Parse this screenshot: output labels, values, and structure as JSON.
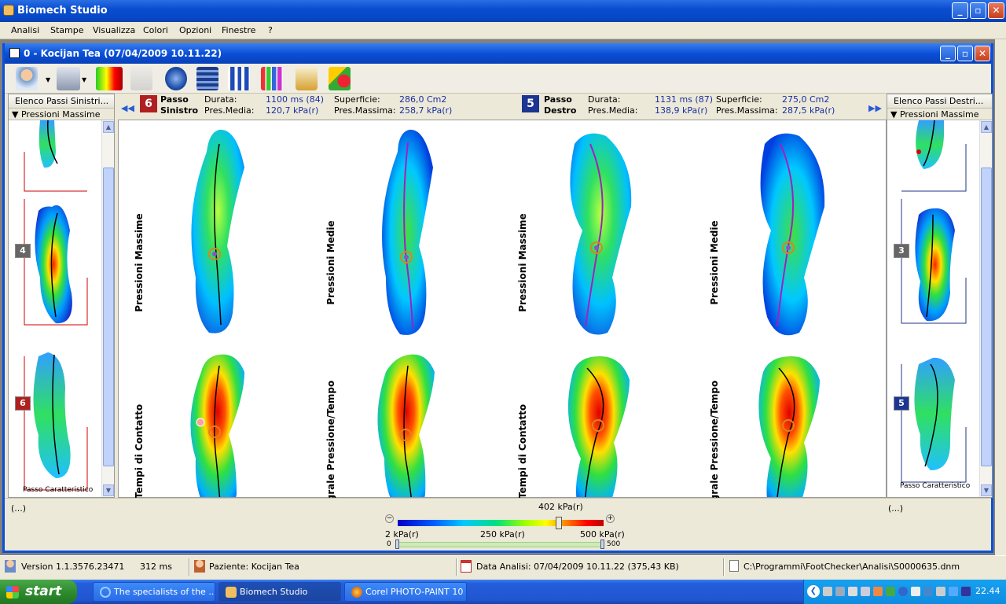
{
  "app": {
    "title": "Biomech Studio"
  },
  "menu": [
    "Analisi",
    "Stampe",
    "Visualizza",
    "Colori",
    "Opzioni",
    "Finestre",
    "?"
  ],
  "child": {
    "title": "0 -  Kocijan Tea  (07/04/2009 10.11.22)"
  },
  "toolbar_icons": [
    "patient-icon",
    "print-icon",
    "pressure-chart-icon",
    "foot-shade-icon",
    "globe-icon",
    "film-icon",
    "feet-icon",
    "bar-chart-icon",
    "scale-icon",
    "shapes-icon"
  ],
  "left_panel": {
    "header": "Elenco Passi Sinistri...",
    "sub": "Pressioni Massime",
    "steps": [
      "4",
      "6"
    ],
    "caption": "Passo Caratteristico"
  },
  "right_panel": {
    "header": "Elenco Passi Destri...",
    "sub": "Pressioni Massime",
    "steps": [
      "3",
      "5"
    ],
    "caption": "Passo Caratteristico"
  },
  "left_step": {
    "number": "6",
    "label1": "Passo",
    "label2": "Sinistro",
    "durata_label": "Durata:",
    "durata": "1100 ms  (84)",
    "premedia_label": "Pres.Media:",
    "premedia": "120,7 kPa(r)",
    "superficie_label": "Superficie:",
    "superficie": "286,0 Cm2",
    "presmax_label": "Pres.Massima:",
    "presmax": "258,7 kPa(r)"
  },
  "right_step": {
    "number": "5",
    "label1": "Passo",
    "label2": "Destro",
    "durata_label": "Durata:",
    "durata": "1131 ms (87)",
    "premedia_label": "Pres.Media:",
    "premedia": "138,9 kPa(r)",
    "superficie_label": "Superficie:",
    "superficie": "275,0 Cm2",
    "presmax_label": "Pres.Massima:",
    "presmax": "287,5 kPa(r)"
  },
  "maps": [
    "Pressioni Massime",
    "Pressioni Medie",
    "Pressioni Massime",
    "Pressioni Medie",
    "Tempi di Contatto",
    "Integrale Pressione/Tempo",
    "Tempi di Contatto",
    "Integrale Pressione/Tempo"
  ],
  "legend": {
    "left_ellipsis": "(...)",
    "right_ellipsis": "(...)",
    "current": "402 kPa(r)",
    "min_label": "2 kPa(r)",
    "mid_label": "250 kPa(r)",
    "max_label": "500 kPa(r)",
    "range_min": "0",
    "range_max": "500",
    "minus": "−",
    "plus": "+"
  },
  "status": {
    "version": "Version 1.1.3576.23471",
    "time": "312 ms",
    "patient": "Paziente: Kocijan  Tea",
    "date": "Data Analisi: 07/04/2009 10.11.22  (375,43 KB)",
    "path": "C:\\Programmi\\FootChecker\\Analisi\\S0000635.dnm"
  },
  "taskbar": {
    "start": "start",
    "tasks": [
      "The specialists of the ...",
      "Biomech Studio",
      "Corel PHOTO-PAINT 10"
    ],
    "clock": "22.44"
  }
}
